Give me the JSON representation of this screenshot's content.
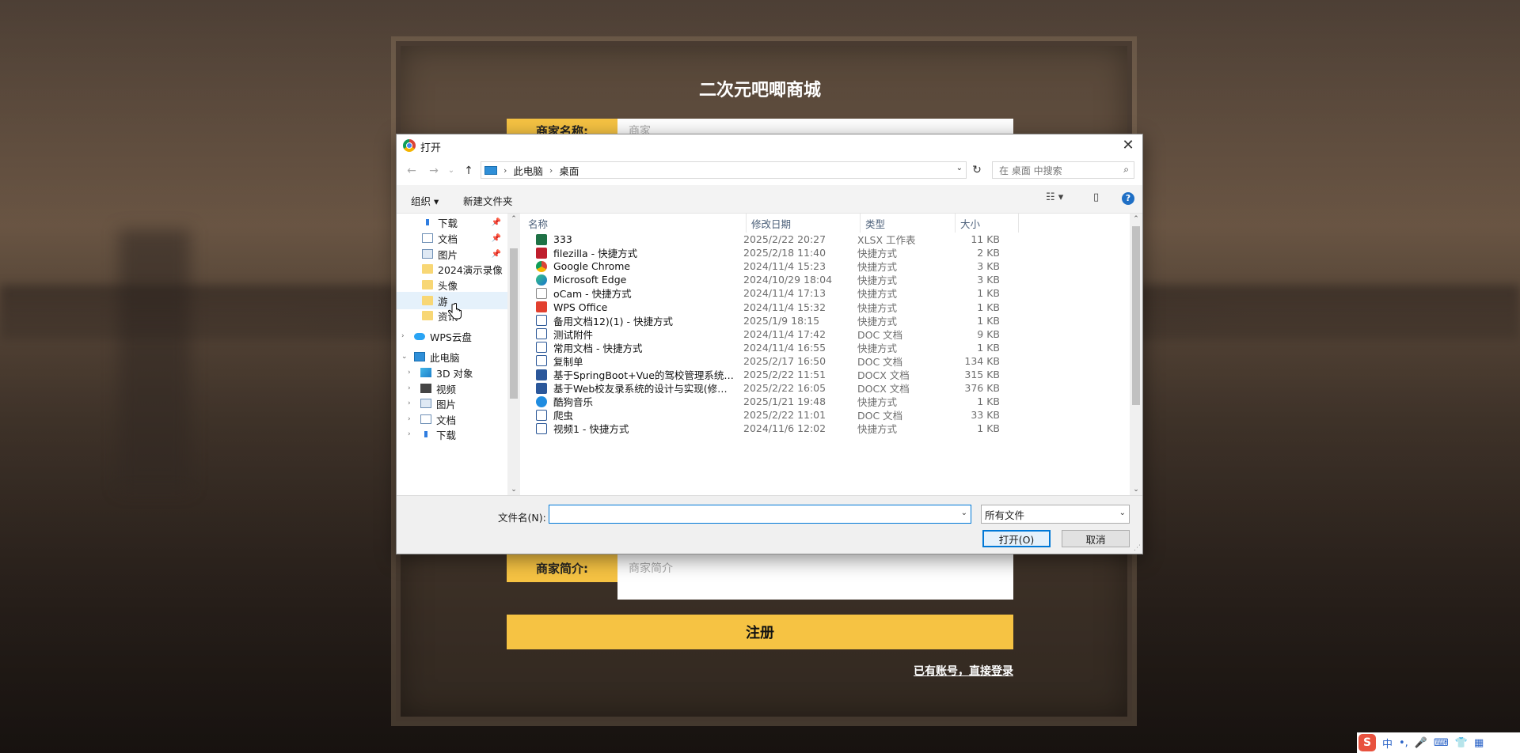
{
  "register": {
    "title": "二次元吧唧商城",
    "shop_name_label": "商家名称:",
    "shop_name_placeholder": "商家",
    "intro_label": "商家简介:",
    "intro_placeholder": "商家简介",
    "submit_label": "注册",
    "login_link": "已有账号，直接登录"
  },
  "dialog": {
    "title": "打开",
    "close": "✕",
    "nav": {
      "back": "←",
      "forward": "→",
      "recent": "⌄",
      "up": "↑",
      "refresh": "↻"
    },
    "breadcrumb": [
      "此电脑",
      "桌面"
    ],
    "search_placeholder": "在 桌面 中搜索",
    "toolbar": {
      "organize": "组织 ▾",
      "new_folder": "新建文件夹",
      "view": "☷ ▾",
      "pane": "▯",
      "help": "?"
    },
    "tree": [
      {
        "label": "下载",
        "icon": "download-icon",
        "pinned": true
      },
      {
        "label": "文档",
        "icon": "document-icon",
        "pinned": true
      },
      {
        "label": "图片",
        "icon": "picture-icon",
        "pinned": true
      },
      {
        "label": "2024演示录像",
        "icon": "folder-icon"
      },
      {
        "label": "头像",
        "icon": "folder-icon"
      },
      {
        "label": "游",
        "icon": "folder-icon",
        "hover": true
      },
      {
        "label": "资讯",
        "icon": "folder-icon"
      },
      {
        "label": "WPS云盘",
        "icon": "cloud-icon",
        "expander": "›"
      },
      {
        "label": "此电脑",
        "icon": "computer-icon",
        "expander": "⌄"
      },
      {
        "label": "3D 对象",
        "icon": "cube-icon",
        "expander": "›"
      },
      {
        "label": "视频",
        "icon": "video-icon",
        "expander": "›"
      },
      {
        "label": "图片",
        "icon": "picture-icon",
        "expander": "›"
      },
      {
        "label": "文档",
        "icon": "document-icon",
        "expander": "›"
      },
      {
        "label": "下载",
        "icon": "download-icon",
        "expander": "›"
      }
    ],
    "columns": {
      "name": "名称",
      "date": "修改日期",
      "type": "类型",
      "size": "大小"
    },
    "files": [
      {
        "name": "333",
        "date": "2025/2/22 20:27",
        "type": "XLSX 工作表",
        "size": "11 KB",
        "icon": "xlsx"
      },
      {
        "name": "filezilla - 快捷方式",
        "date": "2025/2/18 11:40",
        "type": "快捷方式",
        "size": "2 KB",
        "icon": "fz"
      },
      {
        "name": "Google Chrome",
        "date": "2024/11/4 15:23",
        "type": "快捷方式",
        "size": "3 KB",
        "icon": "chrome"
      },
      {
        "name": "Microsoft Edge",
        "date": "2024/10/29 18:04",
        "type": "快捷方式",
        "size": "3 KB",
        "icon": "edge"
      },
      {
        "name": "oCam - 快捷方式",
        "date": "2024/11/4 17:13",
        "type": "快捷方式",
        "size": "1 KB",
        "icon": "ocam"
      },
      {
        "name": "WPS Office",
        "date": "2024/11/4 15:32",
        "type": "快捷方式",
        "size": "1 KB",
        "icon": "wps"
      },
      {
        "name": "备用文档12)(1) - 快捷方式",
        "date": "2025/1/9 18:15",
        "type": "快捷方式",
        "size": "1 KB",
        "icon": "docs"
      },
      {
        "name": "测试附件",
        "date": "2024/11/4 17:42",
        "type": "DOC 文档",
        "size": "9 KB",
        "icon": "docs"
      },
      {
        "name": "常用文档 - 快捷方式",
        "date": "2024/11/4 16:55",
        "type": "快捷方式",
        "size": "1 KB",
        "icon": "docs"
      },
      {
        "name": "复制单",
        "date": "2025/2/17 16:50",
        "type": "DOC 文档",
        "size": "134 KB",
        "icon": "docs"
      },
      {
        "name": "基于SpringBoot+Vue的驾校管理系统的...",
        "date": "2025/2/22 11:51",
        "type": "DOCX 文档",
        "size": "315 KB",
        "icon": "word"
      },
      {
        "name": "基于Web校友录系统的设计与实现(修改...",
        "date": "2025/2/22 16:05",
        "type": "DOCX 文档",
        "size": "376 KB",
        "icon": "word"
      },
      {
        "name": "酷狗音乐",
        "date": "2025/1/21 19:48",
        "type": "快捷方式",
        "size": "1 KB",
        "icon": "music"
      },
      {
        "name": "爬虫",
        "date": "2025/2/22 11:01",
        "type": "DOC 文档",
        "size": "33 KB",
        "icon": "docs"
      },
      {
        "name": "视频1 - 快捷方式",
        "date": "2024/11/6 12:02",
        "type": "快捷方式",
        "size": "1 KB",
        "icon": "docs"
      }
    ],
    "filename_label": "文件名(N):",
    "filename_value": "",
    "filetype": "所有文件",
    "open_label": "打开(O)",
    "cancel_label": "取消"
  },
  "ime": {
    "logo": "S",
    "lang": "中",
    "icons": [
      "•,",
      "🎤",
      "⌨",
      "👕",
      "▦"
    ]
  }
}
